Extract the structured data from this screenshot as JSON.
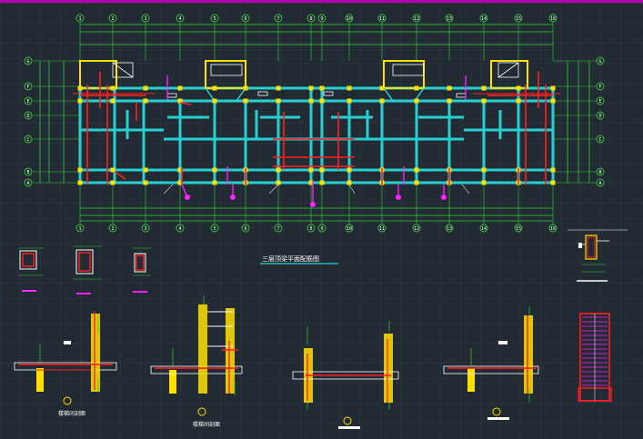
{
  "colors": {
    "background": "#222a33",
    "grid": "#2e3843",
    "axis": "#2fd02f",
    "wall": "#25d0d0",
    "column": "#ffe000",
    "rebar": "#ff2020",
    "leader": "#ff20ff",
    "text": "#ffffff",
    "border": "#b000b0"
  },
  "drawing": {
    "plan_title": "三层顶梁平面配筋图"
  },
  "plan": {
    "column_axes": [
      "1",
      "2",
      "3",
      "4",
      "5",
      "6",
      "7",
      "8",
      "9",
      "10",
      "11",
      "12",
      "13",
      "14",
      "15",
      "16"
    ],
    "row_axes": [
      "G",
      "F",
      "E",
      "D",
      "C",
      "B",
      "A"
    ]
  },
  "details": [
    {
      "id": "1",
      "caption": "楼梯间剖面"
    },
    {
      "id": "2",
      "caption": "楼梯间剖面"
    },
    {
      "id": "3",
      "caption": ""
    },
    {
      "id": "4",
      "caption": ""
    }
  ]
}
